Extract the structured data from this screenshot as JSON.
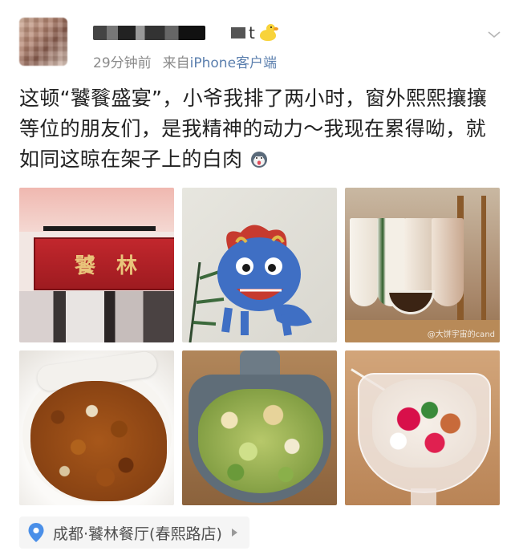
{
  "post": {
    "author_suffix": "t",
    "time": "29分钟前",
    "source_prefix": "来自",
    "source_device": "iPhone客户端",
    "content": "这顿“饕餮盛宴”，小爷我排了两小时，窗外熙熙攘攘等位的朋友们，是我精神的动力～我现在累得呦，就如同这晾在架子上的白肉",
    "images": [
      {
        "name": "restaurant-sign-photo",
        "sign_text": [
          "饕",
          "林"
        ]
      },
      {
        "name": "mural-photo"
      },
      {
        "name": "white-pork-rack-photo",
        "watermark": "@大饼宇宙的cand"
      },
      {
        "name": "kung-pao-chicken-photo"
      },
      {
        "name": "lotus-salad-photo"
      },
      {
        "name": "dessert-bowl-photo"
      }
    ],
    "location": "成都·饕林餐厅(春熙路店)"
  },
  "colors": {
    "link": "#5b7fae",
    "meta": "#8a8a8a",
    "location_pin": "#4a8fe8"
  },
  "icons": {
    "badge": "duck-emoji-icon",
    "emoji": "dog-emoji-icon",
    "menu": "chevron-down-icon",
    "location": "location-pin-icon",
    "location_arrow": "chevron-right-icon"
  }
}
